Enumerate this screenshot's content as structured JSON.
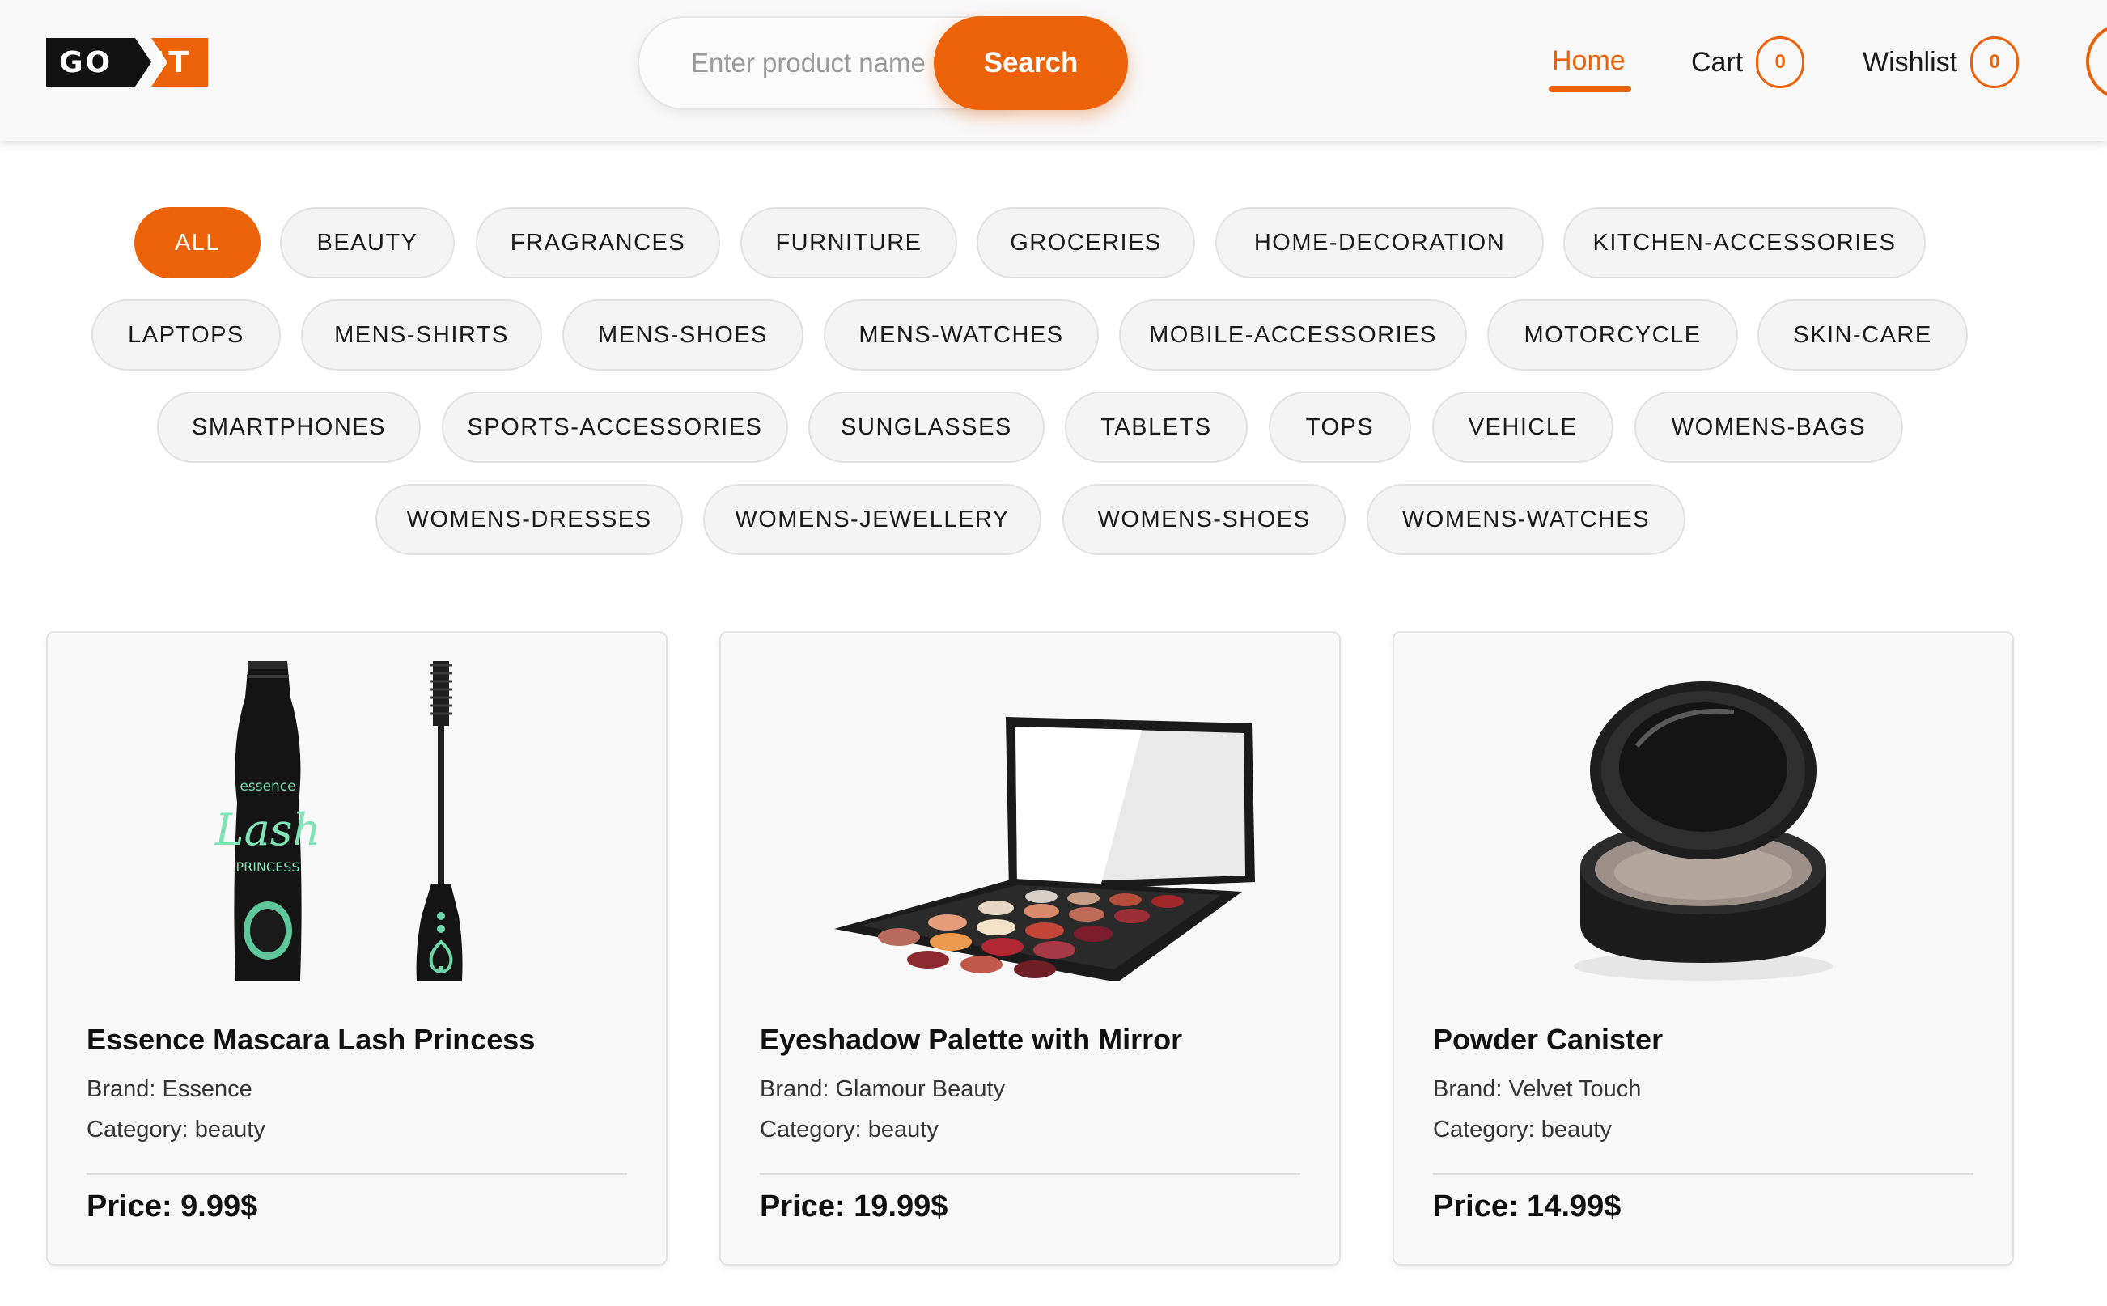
{
  "header": {
    "logo": {
      "left_text": "GO",
      "right_text": "IT"
    },
    "search": {
      "placeholder": "Enter product name",
      "value": "",
      "button_label": "Search"
    },
    "nav": {
      "home_label": "Home",
      "cart_label": "Cart",
      "cart_count": "0",
      "wishlist_label": "Wishlist",
      "wishlist_count": "0"
    }
  },
  "categories": {
    "active": "ALL",
    "items": [
      "ALL",
      "BEAUTY",
      "FRAGRANCES",
      "FURNITURE",
      "GROCERIES",
      "HOME-DECORATION",
      "KITCHEN-ACCESSORIES",
      "LAPTOPS",
      "MENS-SHIRTS",
      "MENS-SHOES",
      "MENS-WATCHES",
      "MOBILE-ACCESSORIES",
      "MOTORCYCLE",
      "SKIN-CARE",
      "SMARTPHONES",
      "SPORTS-ACCESSORIES",
      "SUNGLASSES",
      "TABLETS",
      "TOPS",
      "VEHICLE",
      "WOMENS-BAGS",
      "WOMENS-DRESSES",
      "WOMENS-JEWELLERY",
      "WOMENS-SHOES",
      "WOMENS-WATCHES"
    ]
  },
  "products": [
    {
      "title": "Essence Mascara Lash Princess",
      "brand": "Brand: Essence",
      "category": "Category: beauty",
      "price": "Price: 9.99$",
      "image_icon": "mascara-image",
      "image_text": "essence",
      "image_script": "Lash",
      "image_subtext": "PRINCESS"
    },
    {
      "title": "Eyeshadow Palette with Mirror",
      "brand": "Brand: Glamour Beauty",
      "category": "Category: beauty",
      "price": "Price: 19.99$",
      "image_icon": "eyeshadow-palette-image"
    },
    {
      "title": "Powder Canister",
      "brand": "Brand: Velvet Touch",
      "category": "Category: beauty",
      "price": "Price: 14.99$",
      "image_icon": "powder-canister-image"
    }
  ],
  "colors": {
    "accent": "#ec6209",
    "logo_dark": "#111111",
    "chip_bg": "#f4f4f4",
    "card_bg": "#f8f8f8"
  }
}
